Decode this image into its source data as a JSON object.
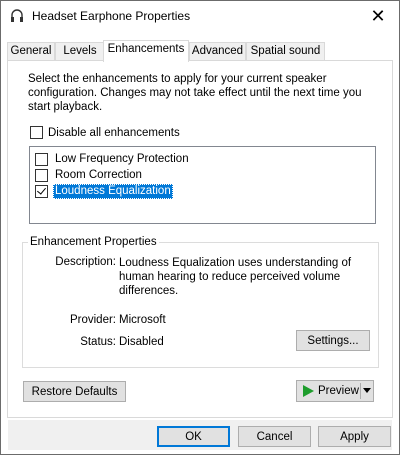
{
  "window": {
    "title": "Headset Earphone Properties"
  },
  "tabs": [
    {
      "label": "General"
    },
    {
      "label": "Levels"
    },
    {
      "label": "Enhancements"
    },
    {
      "label": "Advanced"
    },
    {
      "label": "Spatial sound"
    }
  ],
  "enhancements": {
    "description": "Select the enhancements to apply for your current speaker configuration. Changes may not take effect until the next time you start playback.",
    "disable_all_label": "Disable all enhancements",
    "disable_all_checked": false,
    "items": [
      {
        "label": "Low Frequency Protection",
        "checked": false
      },
      {
        "label": "Room Correction",
        "checked": false
      },
      {
        "label": "Loudness Equalization",
        "checked": true
      }
    ]
  },
  "properties": {
    "group_title": "Enhancement Properties",
    "description_label": "Description:",
    "description_value_lines": [
      "Loudness Equalization uses understanding of",
      "human hearing to reduce perceived volume",
      "differences."
    ],
    "provider_label": "Provider:",
    "provider_value": "Microsoft",
    "status_label": "Status:",
    "status_value": "Disabled",
    "settings_button": "Settings..."
  },
  "buttons": {
    "restore_defaults": "Restore Defaults",
    "preview": "Preview",
    "ok": "OK",
    "cancel": "Cancel",
    "apply": "Apply"
  },
  "icons": {
    "window_icon": "headset-icon",
    "close": "close-icon",
    "preview": "play-icon",
    "preview_dropdown": "chevron-down-icon"
  },
  "colors": {
    "selection": "#0078d7",
    "play": "#1e9d2c"
  }
}
